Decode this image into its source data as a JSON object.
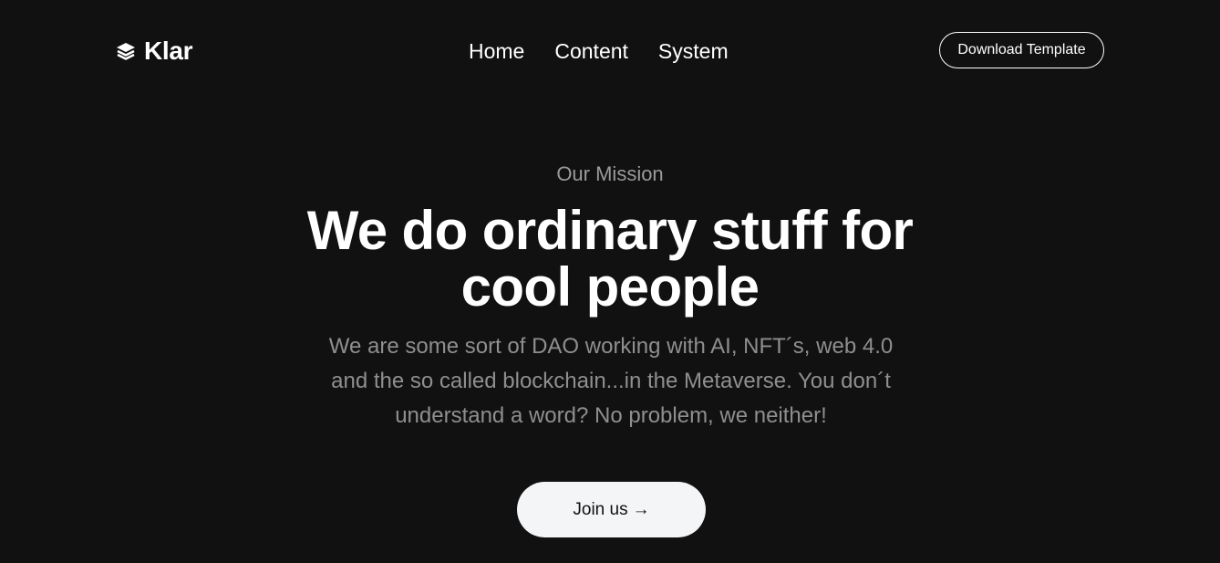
{
  "header": {
    "logo_text": "Klar",
    "logo_icon": "layers-icon",
    "nav": [
      {
        "label": "Home"
      },
      {
        "label": "Content"
      },
      {
        "label": "System"
      }
    ],
    "cta_label": "Download Template"
  },
  "hero": {
    "eyebrow": "Our Mission",
    "headline": "We do ordinary stuff for cool people",
    "subtext": "We are some sort of DAO working with AI, NFT´s, web 4.0 and the so called blockchain...in the Metaverse. You don´t understand a word? No problem, we neither!",
    "join_label": "Join us",
    "join_arrow": "→"
  },
  "colors": {
    "background": "#111111",
    "text": "#ffffff",
    "muted": "#8f8f8f",
    "button_bg": "#f4f5f7"
  }
}
